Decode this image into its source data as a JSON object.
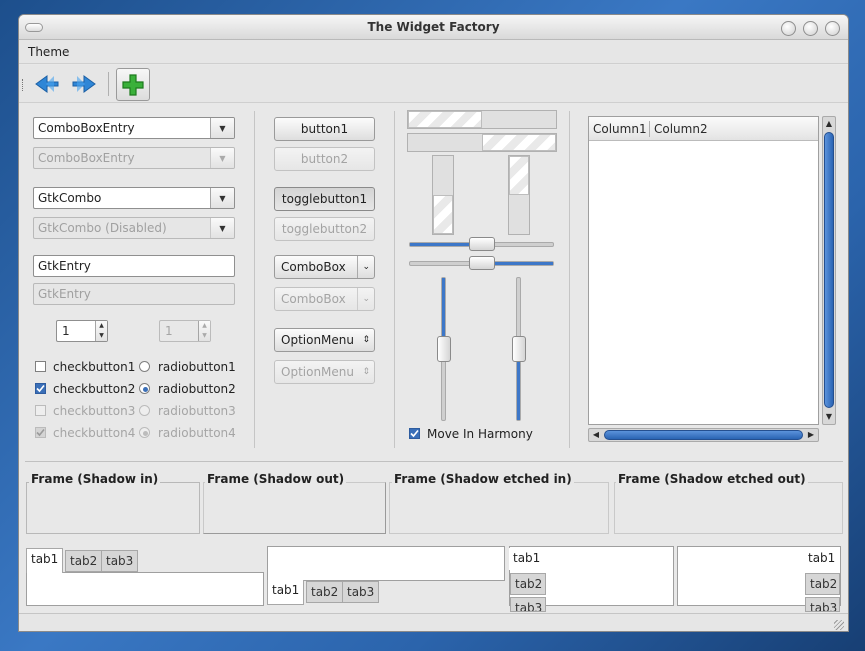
{
  "window": {
    "title": "The Widget Factory"
  },
  "menu": {
    "theme": "Theme"
  },
  "toolbar": {
    "back_icon": "back-arrow-icon",
    "forward_icon": "forward-arrow-icon",
    "add_icon": "add-plus-icon"
  },
  "col1": {
    "combo_entry": "ComboBoxEntry",
    "combo_entry_disabled": "ComboBoxEntry",
    "gtk_combo": "GtkCombo",
    "gtk_combo_disabled": "GtkCombo (Disabled)",
    "entry": "GtkEntry",
    "entry_disabled_placeholder": "GtkEntry",
    "spin_value": "1",
    "spin_disabled_value": "1",
    "checks": [
      {
        "label": "checkbutton1",
        "checked": false,
        "disabled": false
      },
      {
        "label": "checkbutton2",
        "checked": true,
        "disabled": false
      },
      {
        "label": "checkbutton3",
        "checked": false,
        "disabled": true
      },
      {
        "label": "checkbutton4",
        "checked": true,
        "disabled": true
      }
    ],
    "radios": [
      {
        "label": "radiobutton1",
        "selected": false,
        "disabled": false
      },
      {
        "label": "radiobutton2",
        "selected": true,
        "disabled": false
      },
      {
        "label": "radiobutton3",
        "selected": false,
        "disabled": true
      },
      {
        "label": "radiobutton4",
        "selected": true,
        "disabled": true
      }
    ]
  },
  "col2": {
    "button1": "button1",
    "button2": "button2",
    "toggle1": "togglebutton1",
    "toggle2": "togglebutton2",
    "combobox": "ComboBox",
    "combobox_disabled": "ComboBox",
    "optionmenu": "OptionMenu",
    "optionmenu_disabled": "OptionMenu"
  },
  "col3": {
    "progress_h1": 0.5,
    "progress_h2": 0.5,
    "progress_v1": 0.5,
    "progress_v2": 0.5,
    "hscale1": 0.5,
    "hscale2": 0.5,
    "vscale1": 0.5,
    "vscale2": 0.5,
    "move_in_harmony": "Move In Harmony",
    "move_in_harmony_checked": true
  },
  "tree": {
    "columns": [
      "Column1",
      "Column2"
    ]
  },
  "frames": {
    "shadow_in": "Frame (Shadow in)",
    "shadow_out": "Frame (Shadow out)",
    "etched_in": "Frame (Shadow etched in)",
    "etched_out": "Frame (Shadow etched out)"
  },
  "notebooks": {
    "tabs": [
      "tab1",
      "tab2",
      "tab3"
    ]
  },
  "colors": {
    "accent": "#3d77c8",
    "window_bg": "#e8e8e8"
  }
}
